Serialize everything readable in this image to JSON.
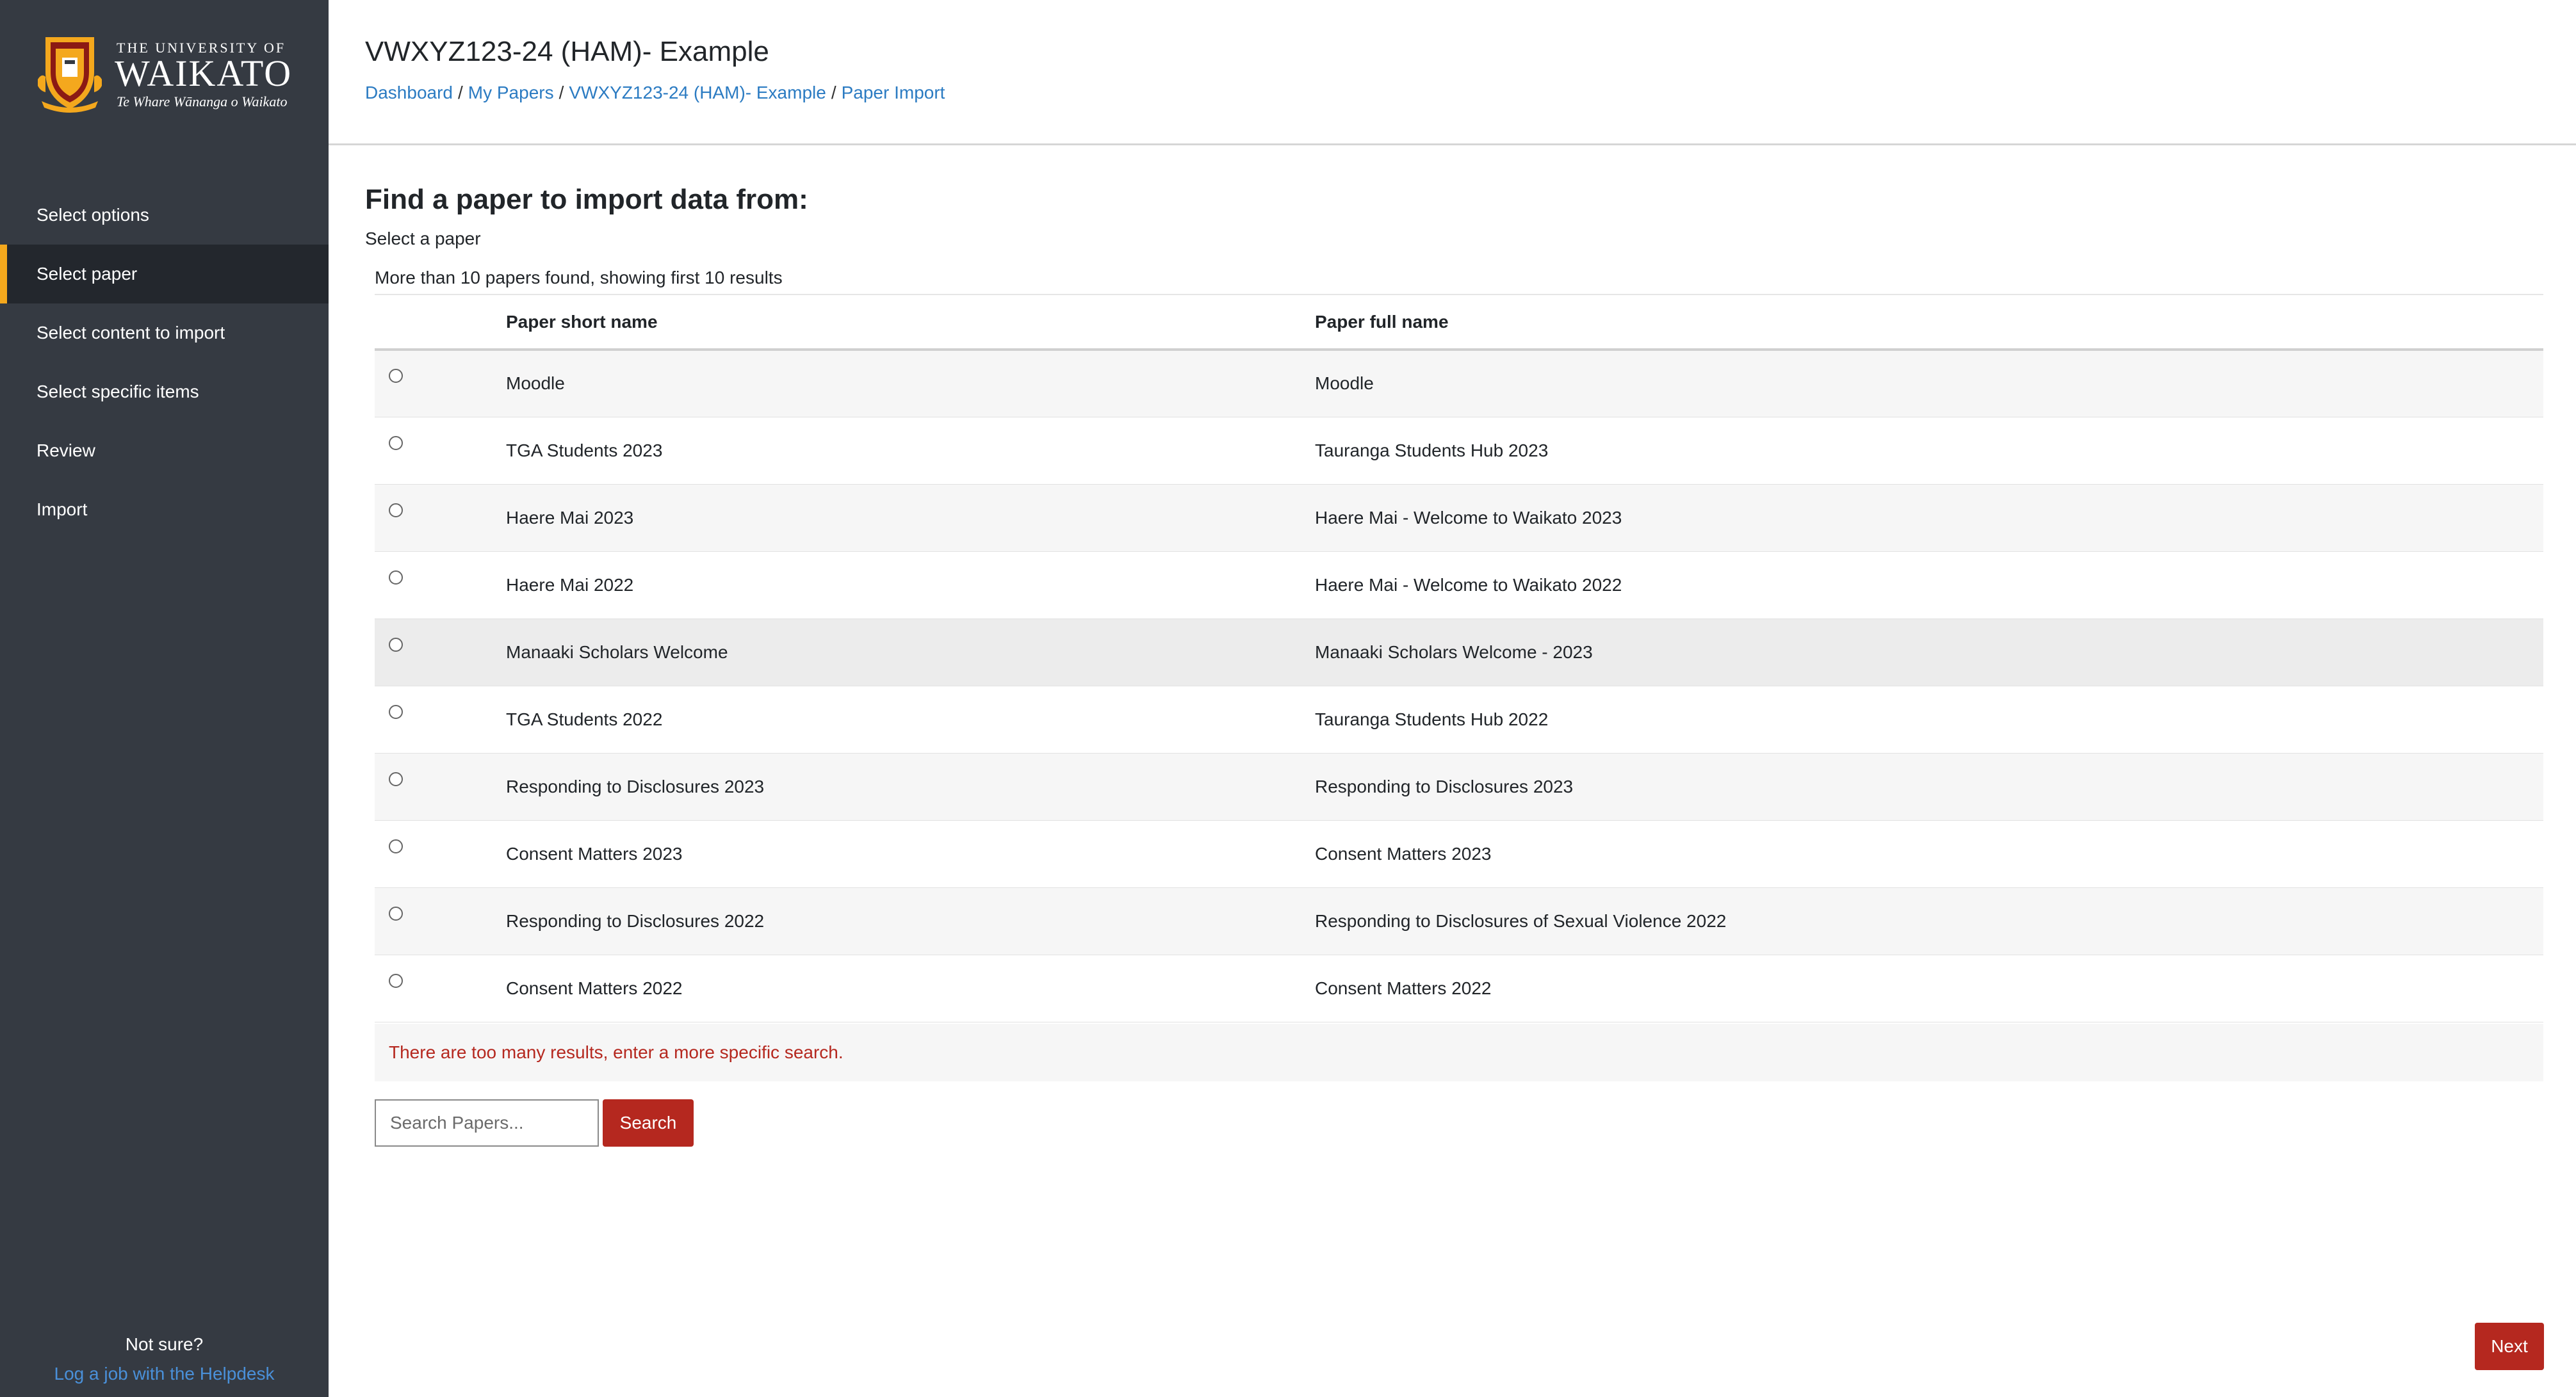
{
  "logo": {
    "line1": "THE UNIVERSITY OF",
    "name": "WAIKATO",
    "tagline": "Te Whare Wānanga o Waikato",
    "crest_icon": "university-crest-icon"
  },
  "sidebar": {
    "items": [
      {
        "label": "Select options",
        "active": false
      },
      {
        "label": "Select paper",
        "active": true
      },
      {
        "label": "Select content to import",
        "active": false
      },
      {
        "label": "Select specific items",
        "active": false
      },
      {
        "label": "Review",
        "active": false
      },
      {
        "label": "Import",
        "active": false
      }
    ],
    "help_text": "Not sure?",
    "help_link": "Log a job with the Helpdesk"
  },
  "header": {
    "title": "VWXYZ123-24 (HAM)- Example",
    "breadcrumb": [
      "Dashboard",
      "My Papers",
      "VWXYZ123-24 (HAM)- Example",
      "Paper Import"
    ]
  },
  "main": {
    "heading": "Find a paper to import data from:",
    "select_label": "Select a paper",
    "result_count_text": "More than 10 papers found, showing first 10 results",
    "table": {
      "columns": [
        "Paper short name",
        "Paper full name"
      ],
      "rows": [
        {
          "short": "Moodle",
          "full": "Moodle"
        },
        {
          "short": "TGA Students 2023",
          "full": "Tauranga Students Hub 2023"
        },
        {
          "short": "Haere Mai 2023",
          "full": "Haere Mai - Welcome to Waikato 2023"
        },
        {
          "short": "Haere Mai 2022",
          "full": "Haere Mai - Welcome to Waikato 2022"
        },
        {
          "short": "Manaaki Scholars Welcome",
          "full": "Manaaki Scholars Welcome - 2023"
        },
        {
          "short": "TGA Students 2022",
          "full": "Tauranga Students Hub 2022"
        },
        {
          "short": "Responding to Disclosures 2023",
          "full": "Responding to Disclosures 2023"
        },
        {
          "short": "Consent Matters 2023",
          "full": "Consent Matters 2023"
        },
        {
          "short": "Responding to Disclosures 2022",
          "full": "Responding to Disclosures of Sexual Violence 2022"
        },
        {
          "short": "Consent Matters 2022",
          "full": "Consent Matters 2022"
        }
      ]
    },
    "too_many_message": "There are too many results, enter a more specific search.",
    "search": {
      "placeholder": "Search Papers...",
      "value": "",
      "button_label": "Search"
    },
    "next_label": "Next"
  },
  "colors": {
    "sidebar_bg": "#353a42",
    "active_accent": "#f4a81d",
    "brand_red": "#b5281f",
    "link_blue": "#2b7bc2"
  }
}
